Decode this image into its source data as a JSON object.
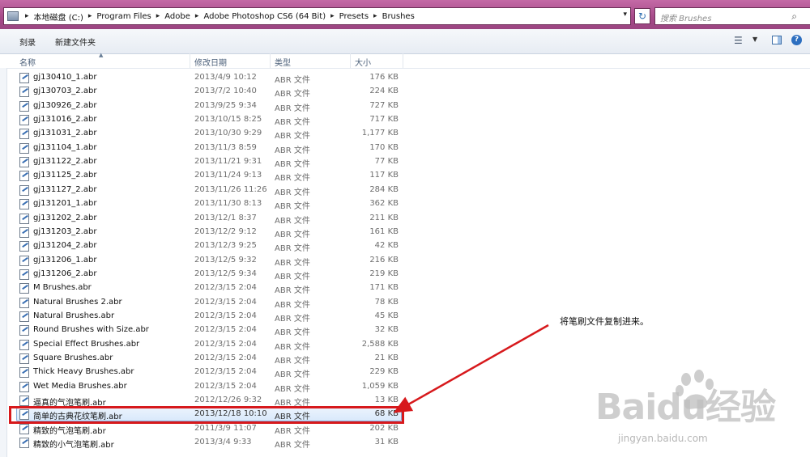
{
  "address_bar": {
    "breadcrumbs": [
      "本地磁盘 (C:)",
      "Program Files",
      "Adobe",
      "Adobe Photoshop CS6 (64 Bit)",
      "Presets",
      "Brushes"
    ],
    "search_placeholder": "搜索 Brushes"
  },
  "toolbar": {
    "burn_label": "刻录",
    "new_folder_label": "新建文件夹"
  },
  "columns": {
    "name": "名称",
    "modified": "修改日期",
    "type": "类型",
    "size": "大小"
  },
  "files": [
    {
      "name": "gj130410_1.abr",
      "date": "2013/4/9 10:12",
      "type": "ABR 文件",
      "size": "176 KB"
    },
    {
      "name": "gj130703_2.abr",
      "date": "2013/7/2 10:40",
      "type": "ABR 文件",
      "size": "224 KB"
    },
    {
      "name": "gj130926_2.abr",
      "date": "2013/9/25 9:34",
      "type": "ABR 文件",
      "size": "727 KB"
    },
    {
      "name": "gj131016_2.abr",
      "date": "2013/10/15 8:25",
      "type": "ABR 文件",
      "size": "717 KB"
    },
    {
      "name": "gj131031_2.abr",
      "date": "2013/10/30 9:29",
      "type": "ABR 文件",
      "size": "1,177 KB"
    },
    {
      "name": "gj131104_1.abr",
      "date": "2013/11/3 8:59",
      "type": "ABR 文件",
      "size": "170 KB"
    },
    {
      "name": "gj131122_2.abr",
      "date": "2013/11/21 9:31",
      "type": "ABR 文件",
      "size": "77 KB"
    },
    {
      "name": "gj131125_2.abr",
      "date": "2013/11/24 9:13",
      "type": "ABR 文件",
      "size": "117 KB"
    },
    {
      "name": "gj131127_2.abr",
      "date": "2013/11/26 11:26",
      "type": "ABR 文件",
      "size": "284 KB"
    },
    {
      "name": "gj131201_1.abr",
      "date": "2013/11/30 8:13",
      "type": "ABR 文件",
      "size": "362 KB"
    },
    {
      "name": "gj131202_2.abr",
      "date": "2013/12/1 8:37",
      "type": "ABR 文件",
      "size": "211 KB"
    },
    {
      "name": "gj131203_2.abr",
      "date": "2013/12/2 9:12",
      "type": "ABR 文件",
      "size": "161 KB"
    },
    {
      "name": "gj131204_2.abr",
      "date": "2013/12/3 9:25",
      "type": "ABR 文件",
      "size": "42 KB"
    },
    {
      "name": "gj131206_1.abr",
      "date": "2013/12/5 9:32",
      "type": "ABR 文件",
      "size": "216 KB"
    },
    {
      "name": "gj131206_2.abr",
      "date": "2013/12/5 9:34",
      "type": "ABR 文件",
      "size": "219 KB"
    },
    {
      "name": "M Brushes.abr",
      "date": "2012/3/15 2:04",
      "type": "ABR 文件",
      "size": "171 KB"
    },
    {
      "name": "Natural Brushes 2.abr",
      "date": "2012/3/15 2:04",
      "type": "ABR 文件",
      "size": "78 KB"
    },
    {
      "name": "Natural Brushes.abr",
      "date": "2012/3/15 2:04",
      "type": "ABR 文件",
      "size": "45 KB"
    },
    {
      "name": "Round Brushes with Size.abr",
      "date": "2012/3/15 2:04",
      "type": "ABR 文件",
      "size": "32 KB"
    },
    {
      "name": "Special Effect Brushes.abr",
      "date": "2012/3/15 2:04",
      "type": "ABR 文件",
      "size": "2,588 KB"
    },
    {
      "name": "Square Brushes.abr",
      "date": "2012/3/15 2:04",
      "type": "ABR 文件",
      "size": "21 KB"
    },
    {
      "name": "Thick Heavy Brushes.abr",
      "date": "2012/3/15 2:04",
      "type": "ABR 文件",
      "size": "229 KB"
    },
    {
      "name": "Wet Media Brushes.abr",
      "date": "2012/3/15 2:04",
      "type": "ABR 文件",
      "size": "1,059 KB"
    },
    {
      "name": "逼真的气泡笔刷.abr",
      "date": "2012/12/26 9:32",
      "type": "ABR 文件",
      "size": "13 KB"
    },
    {
      "name": "简单的古典花纹笔刷.abr",
      "date": "2013/12/18 10:10",
      "type": "ABR 文件",
      "size": "68 KB",
      "selected": true
    },
    {
      "name": "精致的气泡笔刷.abr",
      "date": "2011/3/9 11:07",
      "type": "ABR 文件",
      "size": "202 KB"
    },
    {
      "name": "精致的小气泡笔刷.abr",
      "date": "2013/3/4 9:33",
      "type": "ABR 文件",
      "size": "31 KB"
    }
  ],
  "annotation": {
    "text": "将笔刷文件复制进来。",
    "color": "#d7191c"
  },
  "watermark": {
    "logo": "Baidu经验",
    "url": "jingyan.baidu.com"
  }
}
